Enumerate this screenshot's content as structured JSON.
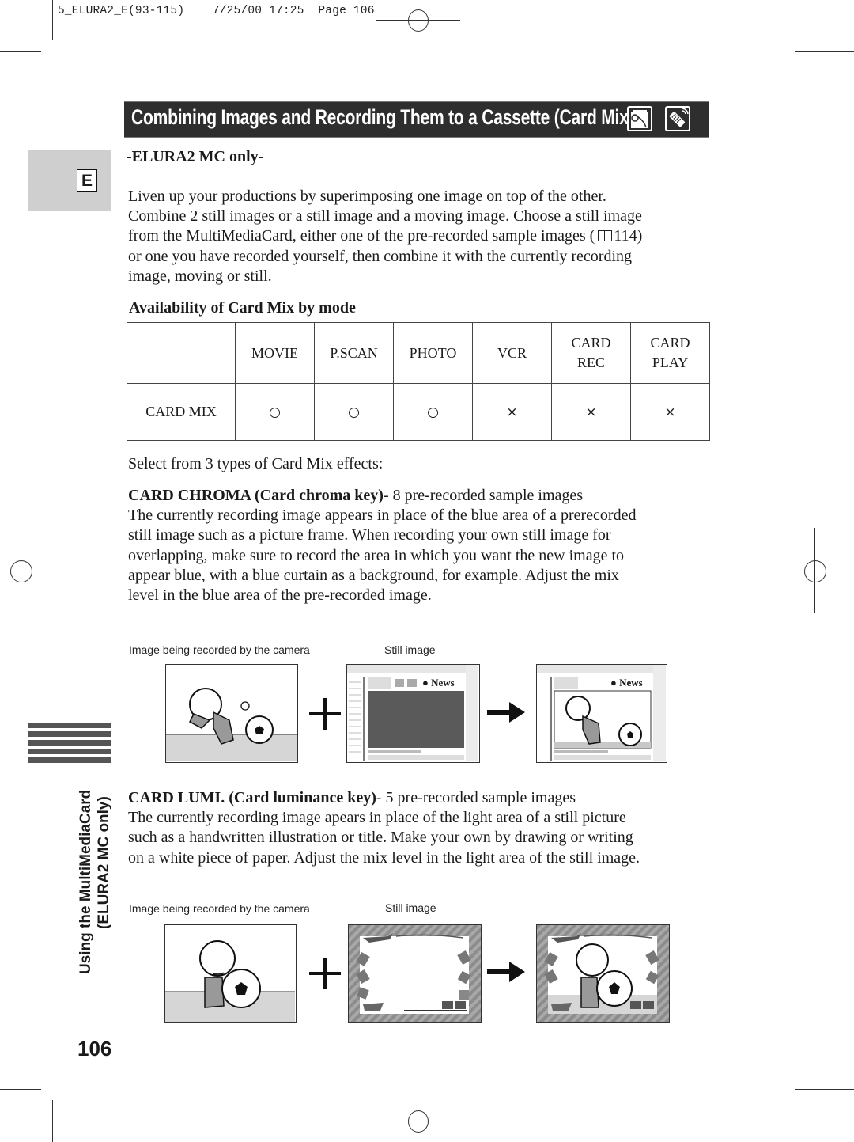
{
  "print_slug": {
    "file": "5_ELURA2_E(93-115)",
    "date": "7/25/00",
    "time": "17:25",
    "page_label": "Page",
    "page_number": "106"
  },
  "header": {
    "title": "Combining Images and Recording Them to a Cassette (Card Mix)",
    "icons": [
      "card-slot-switch-icon",
      "wireless-remote-icon"
    ],
    "background_color": "#2e2e2e"
  },
  "language_tab": {
    "label": "E"
  },
  "model_note": "-ELURA2 MC only-",
  "intro_lines": [
    "Liven up your productions by superimposing one image on top of the other.",
    "Combine 2 still images or a still image and a moving image. Choose a still image",
    "from the MultiMediaCard, either one of the pre-recorded sample images (",
    "or one you have recorded yourself, then combine it with the currently recording",
    "image, moving or still."
  ],
  "intro_ref": {
    "icon": "book-reference-icon",
    "page": "114)"
  },
  "availability": {
    "heading": "Availability of Card Mix by mode",
    "columns": [
      {
        "line1": "MOVIE",
        "line2": ""
      },
      {
        "line1": "P.SCAN",
        "line2": ""
      },
      {
        "line1": "PHOTO",
        "line2": ""
      },
      {
        "line1": "VCR",
        "line2": ""
      },
      {
        "line1": "CARD",
        "line2": "REC"
      },
      {
        "line1": "CARD",
        "line2": "PLAY"
      }
    ],
    "row_label": "CARD MIX",
    "values": [
      "○",
      "○",
      "○",
      "×",
      "×",
      "×"
    ],
    "legend": {
      "available": "○",
      "not_available": "×"
    }
  },
  "effects_intro": "Select from 3 types of Card Mix effects:",
  "card_chroma": {
    "title_bold": "CARD CHROMA (Card chroma key)",
    "title_rest": "- 8 pre-recorded sample images",
    "lines": [
      "The currently recording image appears in place of the blue area of a prerecorded",
      "still image such as a picture frame. When recording your own still image for",
      "overlapping, make sure to record the area in which you want the new image to",
      "appear blue, with a blue curtain as a background, for example. Adjust the mix",
      "level in the blue area of the pre-recorded image."
    ],
    "figure": {
      "caption_camera": "Image being recorded by the camera",
      "caption_still": "Still image",
      "still_label": "News"
    }
  },
  "card_lumi": {
    "title_bold": "CARD LUMI. (Card luminance key)",
    "title_rest": "- 5 pre-recorded sample images",
    "lines": [
      "The currently recording image apears in place of the light area of a still picture",
      "such as a handwritten illustration or title. Make your own by drawing or writing",
      "on a white piece of paper. Adjust the mix level in the light area of the still image."
    ],
    "figure": {
      "caption_camera": "Image being recorded by the camera",
      "caption_still": "Still image"
    }
  },
  "side_section": {
    "line1": "Using the MultiMediaCard",
    "line2": "(ELURA2 MC only)"
  },
  "page_number": "106"
}
